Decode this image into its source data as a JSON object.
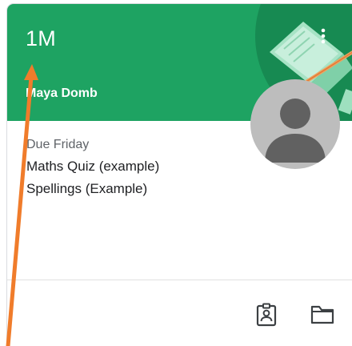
{
  "card": {
    "title": "1M",
    "teacher": "Maya Domb",
    "due_label": "Due Friday",
    "assignments": [
      {
        "label": "Maths Quiz (example)"
      },
      {
        "label": "Spellings (Example)"
      }
    ],
    "header_color": "#1ea362",
    "annotation_color": "#f07c2b"
  },
  "icons": {
    "menu": "more-vert-icon",
    "avatar": "person-icon",
    "gradebook": "assignment-ind-icon",
    "folder": "folder-icon"
  }
}
